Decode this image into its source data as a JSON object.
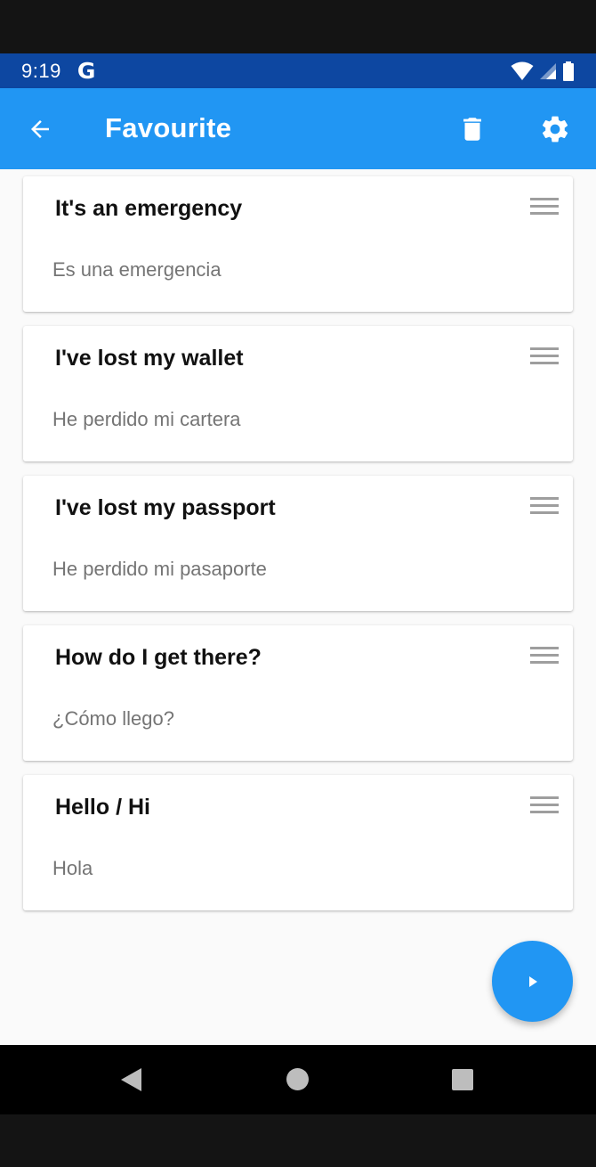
{
  "status_bar": {
    "time": "9:19",
    "g_label": "G",
    "icons": [
      "wifi-icon",
      "cell-signal-icon",
      "battery-icon"
    ]
  },
  "app_bar": {
    "title": "Favourite",
    "back_icon": "arrow-back-icon",
    "delete_icon": "trash-icon",
    "settings_icon": "gear-icon",
    "color": "#2196f3"
  },
  "phrases": [
    {
      "english": "It's an emergency",
      "spanish": "Es una emergencia"
    },
    {
      "english": "I've lost my wallet",
      "spanish": "He perdido mi cartera"
    },
    {
      "english": "I've lost my passport",
      "spanish": "He perdido mi pasaporte"
    },
    {
      "english": "How do I get there?",
      "spanish": "¿Cómo llego?"
    },
    {
      "english": "Hello / Hi",
      "spanish": "Hola"
    }
  ],
  "fab": {
    "icon": "play-icon",
    "color": "#2196f3"
  },
  "nav_bar": {
    "icons": [
      "nav-back-icon",
      "nav-home-icon",
      "nav-recents-icon"
    ]
  }
}
